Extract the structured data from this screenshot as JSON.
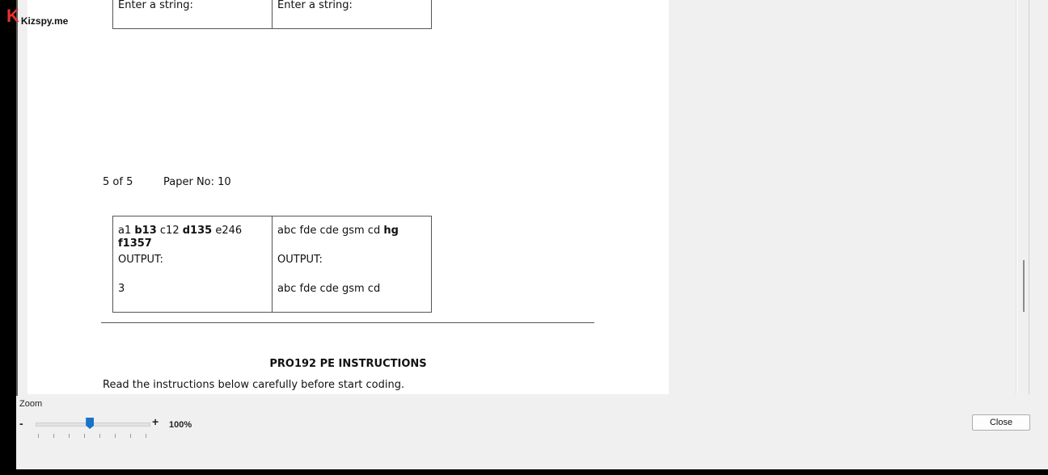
{
  "brand": {
    "logo_letter": "K",
    "name": "Kizspy.me"
  },
  "document": {
    "top_table": {
      "left": "Enter a string:",
      "right": "Enter a string:"
    },
    "page_number": "5 of 5",
    "paper_no": "Paper No: 10",
    "example_table": {
      "left": {
        "input_parts": [
          {
            "text": "a1 ",
            "bold": false
          },
          {
            "text": "b13",
            "bold": true
          },
          {
            "text": " c12 ",
            "bold": false
          },
          {
            "text": "d135",
            "bold": true
          },
          {
            "text": " e246 ",
            "bold": false
          },
          {
            "text": "f1357",
            "bold": true
          }
        ],
        "output_label": "OUTPUT:",
        "output_value": "3"
      },
      "right": {
        "input_parts": [
          {
            "text": "abc fde cde gsm cd ",
            "bold": false
          },
          {
            "text": "hg",
            "bold": true
          }
        ],
        "output_label": "OUTPUT:",
        "output_value": "abc fde cde gsm cd"
      }
    },
    "instructions_title": "PRO192 PE INSTRUCTIONS",
    "instructions_text": "Read the instructions below carefully before start coding."
  },
  "zoom": {
    "label": "Zoom",
    "minus": "-",
    "plus": "+",
    "value_text": "100%",
    "slider_fraction": 0.48
  },
  "actions": {
    "close_label": "Close"
  }
}
